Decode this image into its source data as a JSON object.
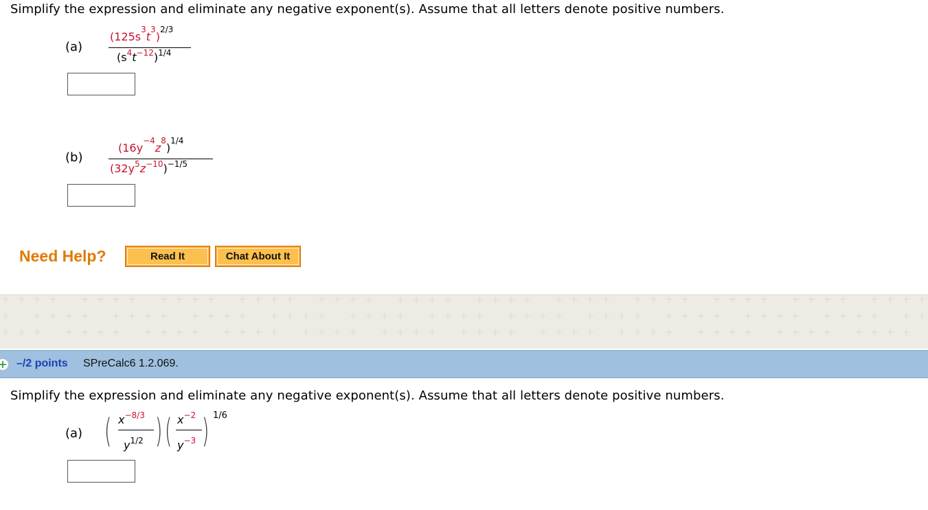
{
  "question1": {
    "prompt": "Simplify the expression and eliminate any negative exponent(s). Assume that all letters denote positive numbers.",
    "part_a": {
      "label": "(a)",
      "num_coef": "(125s",
      "num_exp_s": "3",
      "num_t": "t",
      "num_exp_t": "3",
      "num_close": ")",
      "num_outer_exp": "2/3",
      "den_open": "(s",
      "den_exp_s": "4",
      "den_t": "t",
      "den_exp_t": "−12",
      "den_close": ")",
      "den_outer_exp": "1/4",
      "answer": ""
    },
    "part_b": {
      "label": "(b)",
      "num_open": "(16y",
      "num_exp_y": "−4",
      "num_z": "z",
      "num_exp_z": "8",
      "num_close": ")",
      "num_outer_exp": "1/4",
      "den_open": "(32y",
      "den_exp_y": "5",
      "den_z": "z",
      "den_exp_z": "−10",
      "den_close": ")",
      "den_outer_exp": "−1/5",
      "answer": ""
    }
  },
  "help": {
    "label": "Need Help?",
    "read_it": "Read It",
    "chat_about_it": "Chat About It"
  },
  "question2": {
    "expand_icon": "+",
    "points": "–/2 points",
    "code": "SPreCalc6 1.2.069.",
    "prompt": "Simplify the expression and eliminate any negative exponent(s). Assume that all letters denote positive numbers.",
    "part_a": {
      "label": "(a)",
      "f1_num": "x",
      "f1_num_exp": "−8/3",
      "f1_den": "y",
      "f1_den_exp": "1/2",
      "f2_num": "x",
      "f2_num_exp": "−2",
      "f2_den": "y",
      "f2_den_exp": "−3",
      "outer_exp": "1/6",
      "answer": ""
    }
  },
  "colors": {
    "exponent_red": "#c8102e",
    "need_help_orange": "#e07a00",
    "button_orange": "#fbc04d",
    "question_bar_blue": "#9fc0de",
    "points_blue": "#1a3fb8"
  }
}
